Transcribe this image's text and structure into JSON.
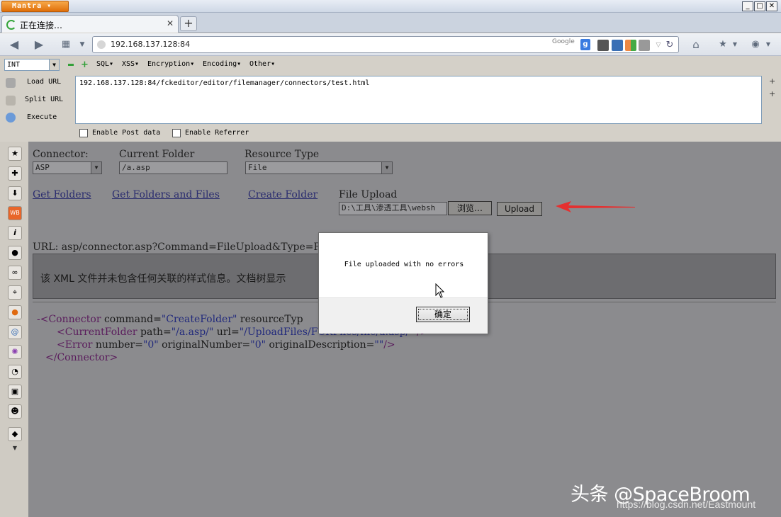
{
  "titlebar": {
    "app_name": "Mantra",
    "minimize": "_",
    "maximize": "□",
    "close": "✕"
  },
  "tabs": [
    {
      "title": "正在连接…",
      "close": "✕"
    }
  ],
  "new_tab": "+",
  "address_bar": {
    "url": "192.168.137.128:84",
    "search_engine": "Google"
  },
  "hackbar": {
    "select_value": "INT",
    "menus": [
      "SQL▾",
      "XSS▾",
      "Encryption▾",
      "Encoding▾",
      "Other▾"
    ],
    "actions": [
      "Load URL",
      "Split URL",
      "Execute"
    ],
    "url_value": "192.168.137.128:84/fckeditor/editor/filemanager/connectors/test.html",
    "enable_post": "Enable Post data",
    "enable_referrer": "Enable Referrer"
  },
  "page": {
    "connector_label": "Connector:",
    "connector_value": "ASP",
    "current_folder_label": "Current Folder",
    "current_folder_value": "/a.asp",
    "resource_type_label": "Resource Type",
    "resource_type_value": "File",
    "link_get_folders": "Get Folders",
    "link_get_folders_files": "Get Folders and Files",
    "link_create_folder": "Create Folder",
    "file_upload_label": "File Upload",
    "file_path_value": "D:\\工具\\渗透工具\\websh",
    "browse_button": "浏览…",
    "upload_button": "Upload",
    "url_line": "URL: asp/connector.asp?Command=FileUpload&Type=File",
    "xml_message": "该 XML 文件并未包含任何关联的样式信息。文档树显示",
    "xml_lines": {
      "line1_a": "-<",
      "line1_tag": "Connector",
      "line1_attr1": " command=",
      "line1_val1": "\"CreateFolder\"",
      "line1_attr2": " resourceTyp",
      "line2_a": "<",
      "line2_tag": "CurrentFolder",
      "line2_attr1": " path=",
      "line2_val1": "\"/a.asp/\"",
      "line2_attr2": " url=",
      "line2_val2": "\"/UploadFiles/FCKFiles/file/a.asp/\"",
      "line2_end": " />",
      "line3_a": "<",
      "line3_tag": "Error",
      "line3_attr1": " number=",
      "line3_val1": "\"0\"",
      "line3_attr2": " originalNumber=",
      "line3_val2": "\"0\"",
      "line3_attr3": " originalDescription=",
      "line3_val3": "\"\"",
      "line3_end": "/>",
      "line4": "</Connector>"
    }
  },
  "dialog": {
    "message": "File uploaded with no errors",
    "ok_button": "确定"
  },
  "watermark": {
    "line1": "头条 @SpaceBroom",
    "line2": "https://blog.csdn.net/Eastmount"
  },
  "colors": {
    "overlay_gray": "#8b8b8e",
    "link": "#2b2d6f",
    "xml_tag": "#5a1c5c",
    "xml_value": "#222a7c",
    "arrow_red": "#e53030",
    "app_orange": "#e8851f"
  }
}
